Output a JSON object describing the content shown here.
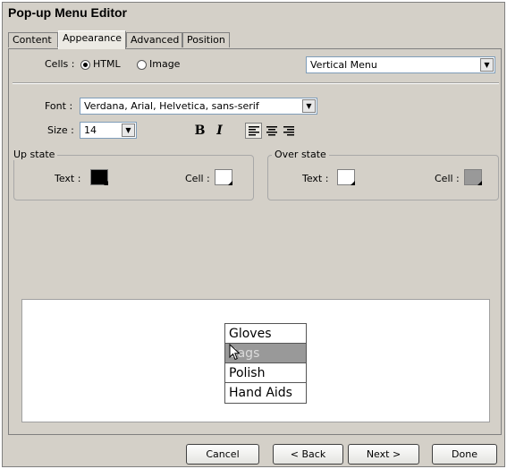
{
  "window": {
    "title": "Pop-up Menu Editor"
  },
  "tabs": [
    "Content",
    "Appearance",
    "Advanced",
    "Position"
  ],
  "active_tab": "Appearance",
  "cells": {
    "label": "Cells :",
    "option_html": "HTML",
    "option_image": "Image",
    "selected": "HTML",
    "orientation": "Vertical Menu"
  },
  "font": {
    "label": "Font :",
    "value": "Verdana, Arial, Helvetica, sans-serif"
  },
  "size": {
    "label": "Size :",
    "value": "14"
  },
  "format": {
    "bold": "B",
    "italic": "I",
    "align_selected": "left"
  },
  "up_state": {
    "legend": "Up state",
    "text_label": "Text :",
    "text_color": "#000000",
    "cell_label": "Cell :",
    "cell_color": "#ffffff"
  },
  "over_state": {
    "legend": "Over state",
    "text_label": "Text :",
    "text_color": "#ffffff",
    "cell_label": "Cell :",
    "cell_color": "#999999"
  },
  "preview": {
    "items": [
      "Gloves",
      "Bags",
      "Polish",
      "Hand Aids"
    ],
    "hover_index": 1
  },
  "buttons": {
    "cancel": "Cancel",
    "back": "< Back",
    "next": "Next >",
    "done": "Done"
  }
}
